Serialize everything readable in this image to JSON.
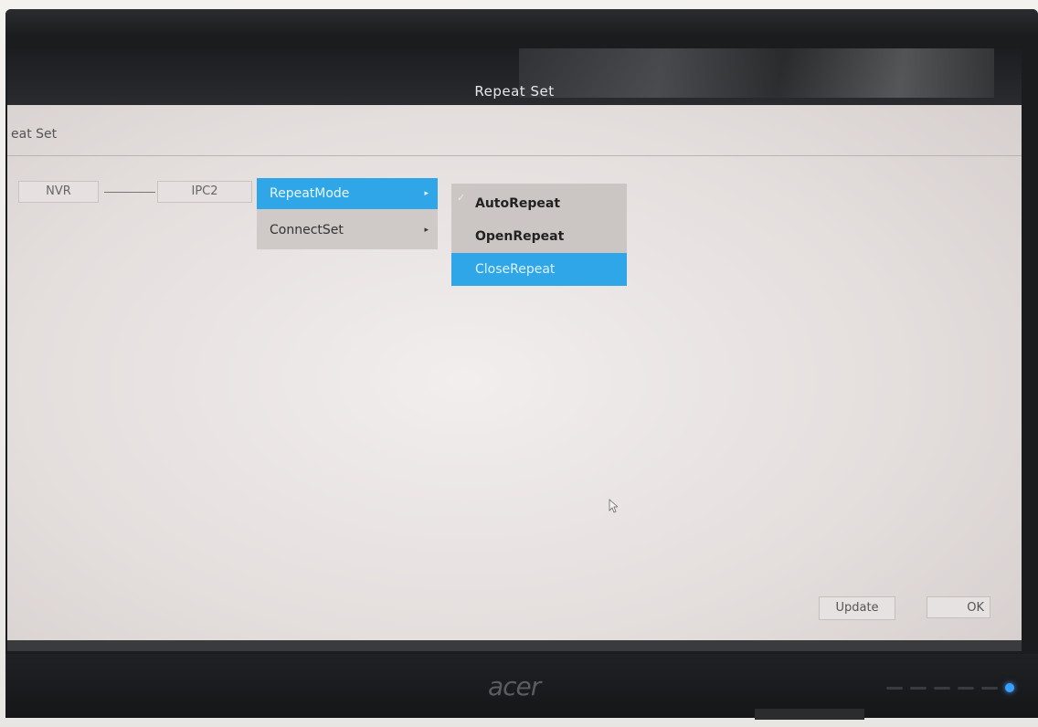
{
  "window": {
    "title": "Repeat Set"
  },
  "breadcrumb": "eat Set",
  "topology": {
    "nodes": [
      "NVR",
      "IPC2"
    ]
  },
  "menu": {
    "items": [
      {
        "label": "RepeatMode",
        "active": true
      },
      {
        "label": "ConnectSet",
        "active": false
      }
    ]
  },
  "submenu": {
    "items": [
      {
        "label": "AutoRepeat",
        "checked": true
      },
      {
        "label": "OpenRepeat",
        "checked": false
      },
      {
        "label": "CloseRepeat",
        "highlighted": true
      }
    ]
  },
  "buttons": {
    "update": "Update",
    "ok": "OK"
  },
  "monitor": {
    "brand": "acer"
  },
  "colors": {
    "accent": "#2fa6e8"
  }
}
